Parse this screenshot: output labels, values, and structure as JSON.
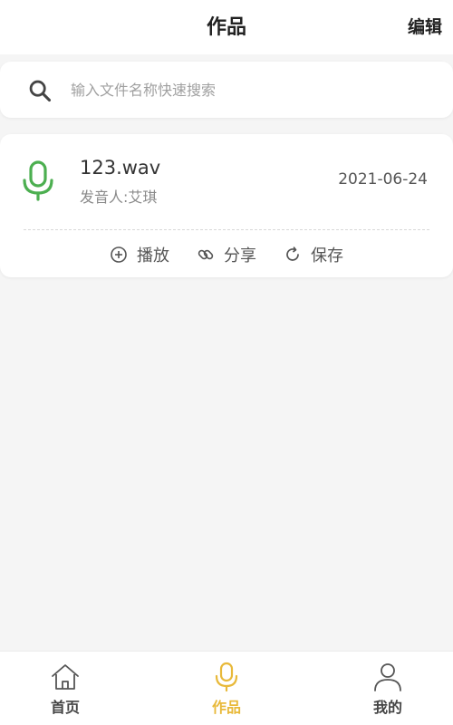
{
  "header": {
    "title": "作品",
    "edit_label": "编辑"
  },
  "search": {
    "placeholder": "输入文件名称快速搜索",
    "value": ""
  },
  "works": [
    {
      "file_name": "123.wav",
      "speaker_label": "发音人:",
      "speaker_name": "艾琪",
      "date": "2021-06-24",
      "icon": "microphone-icon",
      "actions": [
        {
          "icon": "play-circle-icon",
          "label": "播放"
        },
        {
          "icon": "link-icon",
          "label": "分享"
        },
        {
          "icon": "refresh-icon",
          "label": "保存"
        }
      ]
    }
  ],
  "tabbar": {
    "items": [
      {
        "icon": "home-icon",
        "label": "首页",
        "active": false
      },
      {
        "icon": "microphone-icon",
        "label": "作品",
        "active": true
      },
      {
        "icon": "user-icon",
        "label": "我的",
        "active": false
      }
    ]
  },
  "colors": {
    "accent": "#e8b93a",
    "mic_green": "#4caf50",
    "background": "#f5f5f5"
  }
}
